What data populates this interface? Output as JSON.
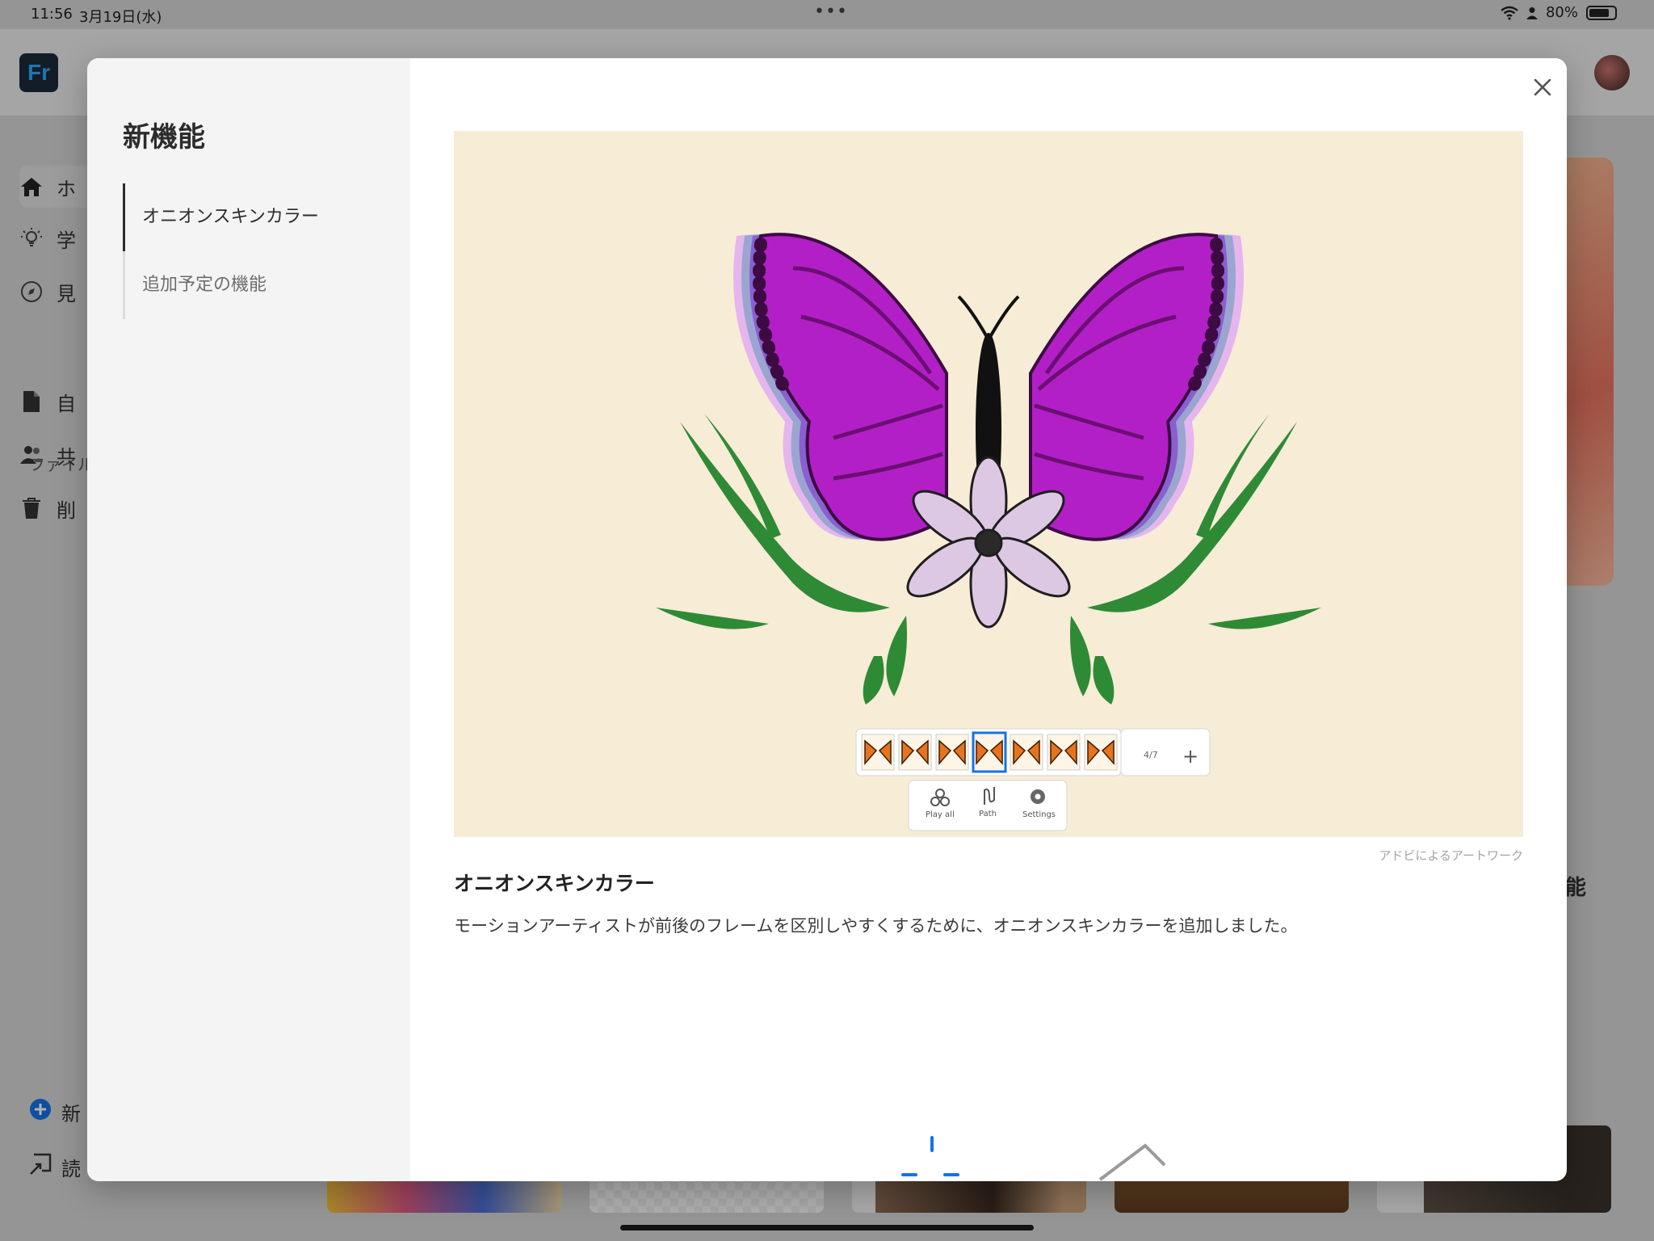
{
  "status_bar": {
    "time": "11:56",
    "date": "3月19日(水)",
    "battery": "80%",
    "battery_level": 0.8
  },
  "background_app": {
    "logo": "Fr",
    "nav": [
      {
        "label": "ホ",
        "icon": "home-icon"
      },
      {
        "label": "学",
        "icon": "lightbulb-icon"
      },
      {
        "label": "見",
        "icon": "compass-icon"
      }
    ],
    "section_label": "ファイル",
    "files_nav": [
      {
        "label": "自",
        "icon": "document-icon"
      },
      {
        "label": "共",
        "icon": "people-icon"
      },
      {
        "label": "削",
        "icon": "trash-icon"
      }
    ],
    "bottom_nav": [
      {
        "label": "新",
        "icon": "plus-circle-icon"
      },
      {
        "label": "読",
        "icon": "import-icon"
      }
    ],
    "right_label": "能"
  },
  "modal": {
    "title": "新機能",
    "features": [
      {
        "label": "オニオンスキンカラー",
        "active": true
      },
      {
        "label": "追加予定の機能",
        "active": false
      }
    ],
    "close_icon": "close-icon",
    "image": {
      "credit": "アドビによるアートワーク",
      "timeline": {
        "counter": "4/7",
        "add": "+",
        "tools": [
          {
            "label": "Play all",
            "icon": "play-all-icon"
          },
          {
            "label": "Path",
            "icon": "path-icon"
          },
          {
            "label": "Settings",
            "icon": "settings-icon"
          }
        ]
      }
    },
    "heading": "オニオンスキンカラー",
    "description": "モーションアーティストが前後のフレームを区別しやすくするために、オニオンスキンカラーを追加しました。"
  },
  "colors": {
    "accent": "#1473e6",
    "butterfly": "#a11cbf",
    "leaf": "#2f8a36",
    "canvas": "#f7ecd6"
  }
}
